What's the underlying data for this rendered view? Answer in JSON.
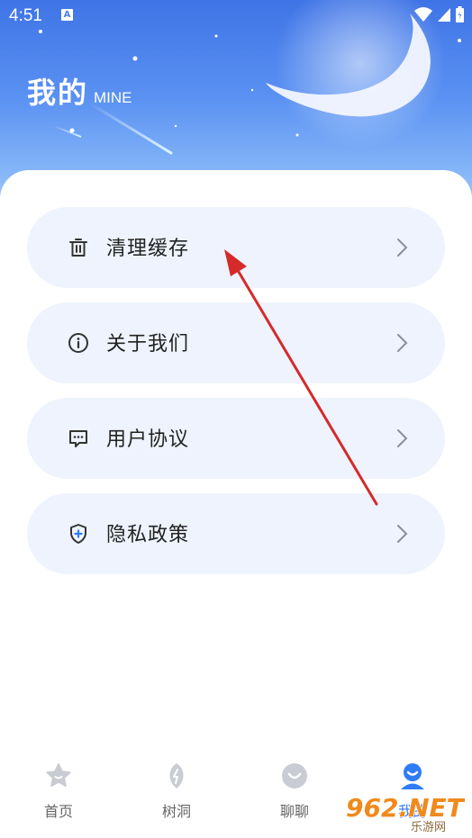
{
  "status_bar": {
    "time": "4:51",
    "notification_badge": "A"
  },
  "header": {
    "title": "我的",
    "subtitle": "MINE"
  },
  "menu": {
    "items": [
      {
        "label": "清理缓存",
        "icon": "trash-icon"
      },
      {
        "label": "关于我们",
        "icon": "info-icon"
      },
      {
        "label": "用户协议",
        "icon": "message-icon"
      },
      {
        "label": "隐私政策",
        "icon": "shield-icon"
      }
    ]
  },
  "tabbar": {
    "tabs": [
      {
        "label": "首页",
        "icon": "star-icon",
        "active": false
      },
      {
        "label": "树洞",
        "icon": "leaf-icon",
        "active": false
      },
      {
        "label": "聊聊",
        "icon": "smile-icon",
        "active": false
      },
      {
        "label": "我的",
        "icon": "user-icon",
        "active": true
      }
    ]
  },
  "watermark": {
    "brand": "962.NET",
    "sub": "乐游网"
  },
  "colors": {
    "accent": "#2f7cf6",
    "hero": "#4f86ee",
    "menu_bg": "#eef3fd",
    "arrow": "#d42a2a"
  }
}
